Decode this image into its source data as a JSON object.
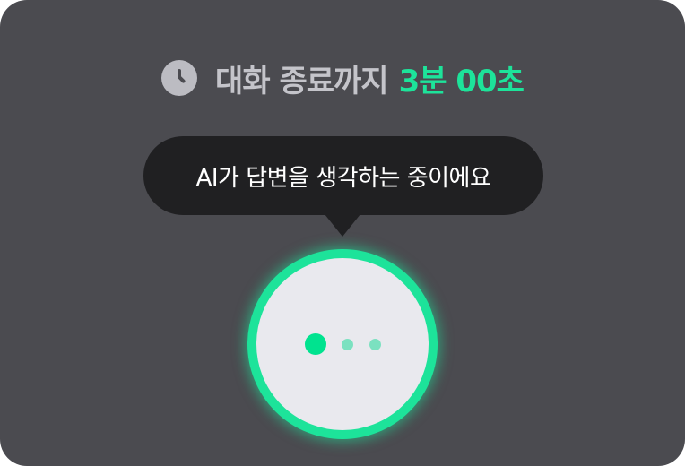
{
  "timer": {
    "label": "대화 종료까지",
    "value": "3분 00초",
    "icon": "clock-icon",
    "label_color": "#c4c4ca",
    "value_color": "#1de39a"
  },
  "status_bubble": {
    "text": "AI가 답변을 생각하는 중이에요",
    "background_color": "#202022"
  },
  "voice_indicator": {
    "state": "thinking",
    "ring_color": "#1de39a",
    "dots": [
      "active",
      "dim",
      "dim"
    ]
  },
  "colors": {
    "panel_background": "#4b4b50",
    "accent": "#1de39a"
  }
}
